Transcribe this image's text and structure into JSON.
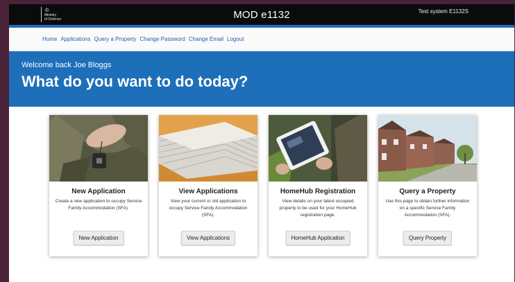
{
  "header": {
    "logo_text_line1": "Ministry",
    "logo_text_line2": "of Defence",
    "title": "MOD e1132",
    "environment": "Test system E1132S"
  },
  "nav": {
    "items": [
      {
        "label": "Home"
      },
      {
        "label": "Applications"
      },
      {
        "label": "Query a Property"
      },
      {
        "label": "Change Password"
      },
      {
        "label": "Change Email"
      },
      {
        "label": "Logout"
      }
    ]
  },
  "hero": {
    "welcome": "Welcome back Joe Bloggs",
    "heading": "What do you want to do today?"
  },
  "cards": [
    {
      "title": "New Application",
      "description": "Create a new application to occupy Service Family Accommodation (SFA).",
      "button": "New Application"
    },
    {
      "title": "View Applications",
      "description": "View your current or old application to occupy Service Family Accommodation (SFA).",
      "button": "View Applications"
    },
    {
      "title": "HomeHub Registration",
      "description": "View details on your latest occupied property to be used for your HomeHub registration page.",
      "button": "HomeHub Application"
    },
    {
      "title": "Query a Property",
      "description": "Use this page to obtain further information on a specific Service Family Accommodation (SFA).",
      "button": "Query Property"
    }
  ],
  "colors": {
    "outer_background": "#4a2338",
    "top_bar": "#0b0b0b",
    "hero_blue": "#1e6fb9",
    "nav_link": "#1f5fa8"
  }
}
